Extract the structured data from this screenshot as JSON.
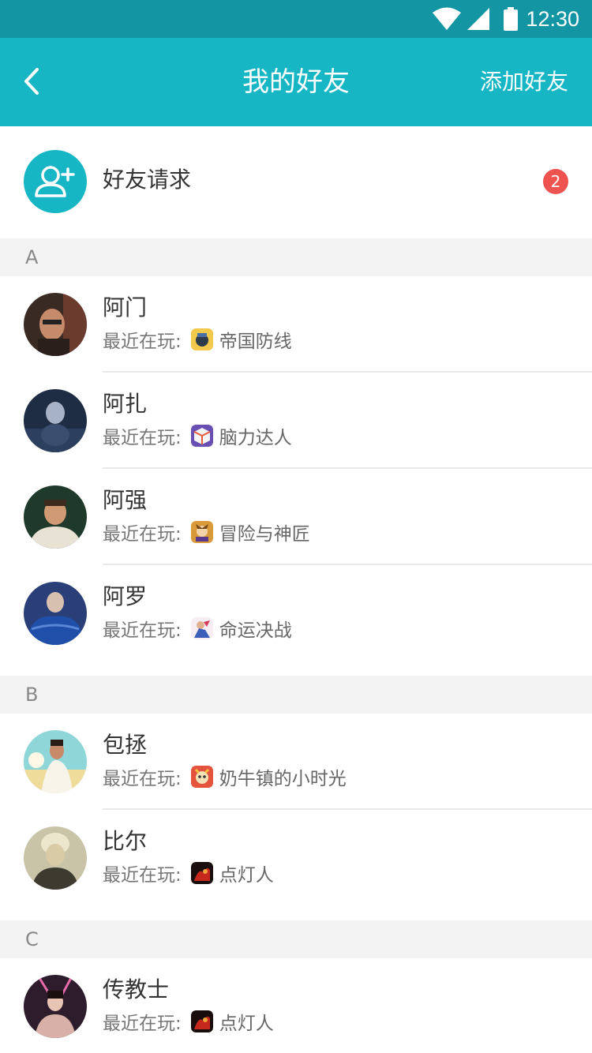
{
  "status_bar": {
    "time": "12:30",
    "wifi_icon": "wifi-icon",
    "signal_icon": "cell-signal-icon",
    "battery_icon": "battery-icon"
  },
  "nav": {
    "back_icon": "chevron-left-icon",
    "title": "我的好友",
    "action_label": "添加好友"
  },
  "friend_request": {
    "icon": "add-user-icon",
    "label": "好友请求",
    "badge_count": "2"
  },
  "recent_label": "最近在玩:",
  "sections": [
    {
      "letter": "A",
      "friends": [
        {
          "name": "阿门",
          "game": "帝国防线"
        },
        {
          "name": "阿扎",
          "game": "脑力达人"
        },
        {
          "name": "阿强",
          "game": "冒险与神匠"
        },
        {
          "name": "阿罗",
          "game": "命运决战"
        }
      ]
    },
    {
      "letter": "B",
      "friends": [
        {
          "name": "包拯",
          "game": "奶牛镇的小时光"
        },
        {
          "name": "比尔",
          "game": "点灯人"
        }
      ]
    },
    {
      "letter": "C",
      "friends": [
        {
          "name": "传教士",
          "game": "点灯人"
        }
      ]
    }
  ],
  "colors": {
    "status_bar": "#1395a4",
    "nav_bar": "#16b6c5",
    "badge": "#ef5350",
    "section_bg": "#f3f3f3"
  }
}
